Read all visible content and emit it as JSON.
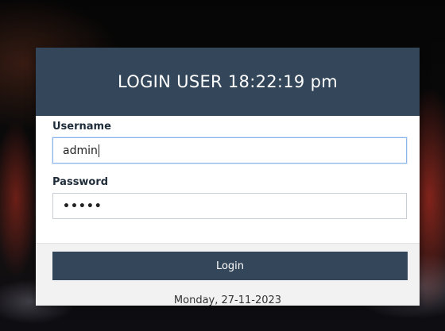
{
  "header": {
    "title": "LOGIN USER 18:22:19 pm"
  },
  "form": {
    "username_label": "Username",
    "username_value": "admin",
    "password_label": "Password",
    "password_value": "•••••"
  },
  "footer": {
    "login_label": "Login",
    "date_text": "Monday, 27-11-2023"
  },
  "colors": {
    "header_bg": "#34475a",
    "button_bg": "#34475a"
  }
}
